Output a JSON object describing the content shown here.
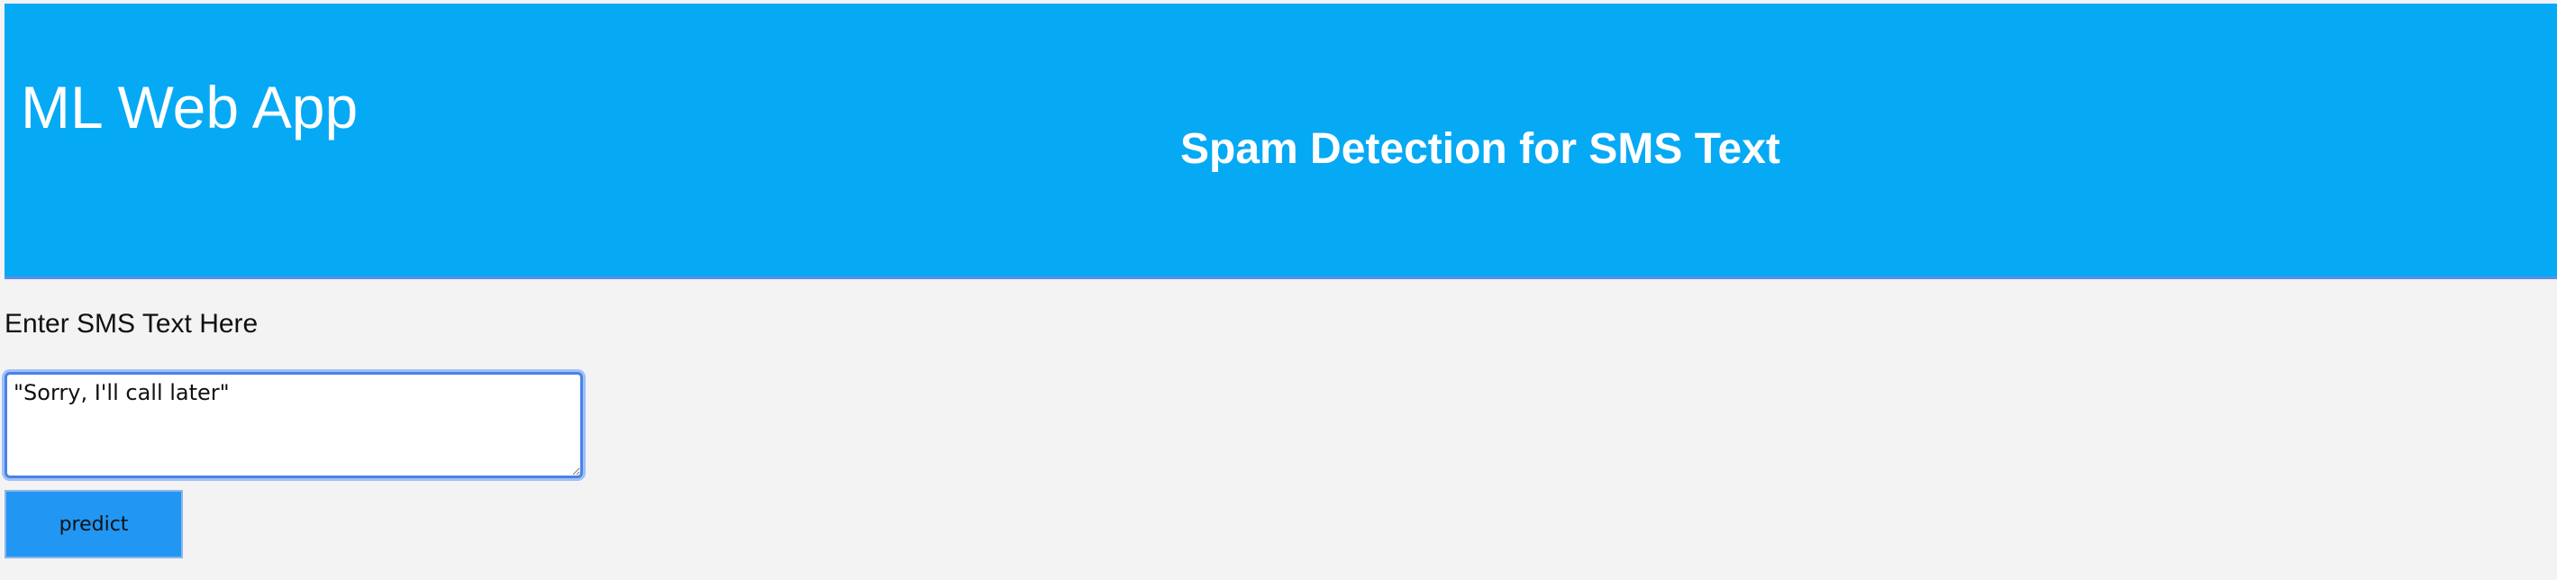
{
  "header": {
    "brand": "ML Web App",
    "title": "Spam Detection for SMS Text",
    "background_color": "#06a9f4"
  },
  "form": {
    "label": "Enter SMS Text Here",
    "textarea_value": "\"Sorry, I'll call later\"",
    "predict_label": "predict",
    "button_color": "#2196f3"
  }
}
